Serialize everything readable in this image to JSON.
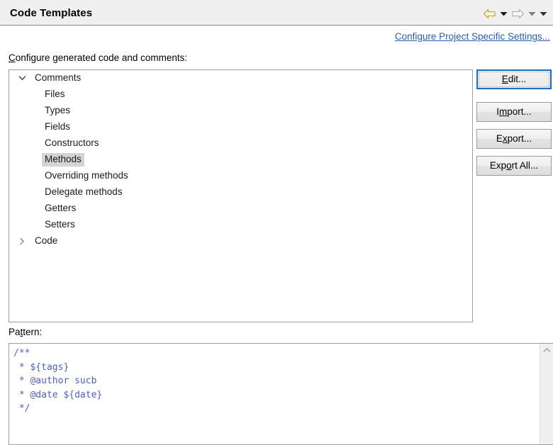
{
  "header": {
    "title": "Code Templates",
    "nav": [
      {
        "name": "back-arrow-icon",
        "glyph": "back",
        "color": "#d9b84c",
        "enabled": true
      },
      {
        "name": "back-dropdown-caret-icon",
        "glyph": "caret",
        "color": "#1a1a1a",
        "enabled": true
      },
      {
        "name": "forward-arrow-icon",
        "glyph": "forward",
        "color": "#b0b0b0",
        "enabled": false
      },
      {
        "name": "forward-dropdown-caret-icon",
        "glyph": "caret",
        "color": "#8a8a8a",
        "enabled": false
      },
      {
        "name": "menu-dropdown-caret-icon",
        "glyph": "caret",
        "color": "#2b2b5e",
        "enabled": true
      }
    ]
  },
  "links": {
    "project_specific_settings": "Configure Project Specific Settings..."
  },
  "section": {
    "label_mnemonic": "C",
    "label_rest": "onfigure generated code and comments:"
  },
  "tree": {
    "nodes": [
      {
        "label": "Comments",
        "level": 0,
        "twisty": "expanded",
        "selected": false
      },
      {
        "label": "Files",
        "level": 1,
        "twisty": "none",
        "selected": false
      },
      {
        "label": "Types",
        "level": 1,
        "twisty": "none",
        "selected": false
      },
      {
        "label": "Fields",
        "level": 1,
        "twisty": "none",
        "selected": false
      },
      {
        "label": "Constructors",
        "level": 1,
        "twisty": "none",
        "selected": false
      },
      {
        "label": "Methods",
        "level": 1,
        "twisty": "none",
        "selected": true
      },
      {
        "label": "Overriding methods",
        "level": 1,
        "twisty": "none",
        "selected": false
      },
      {
        "label": "Delegate methods",
        "level": 1,
        "twisty": "none",
        "selected": false
      },
      {
        "label": "Getters",
        "level": 1,
        "twisty": "none",
        "selected": false
      },
      {
        "label": "Setters",
        "level": 1,
        "twisty": "none",
        "selected": false
      },
      {
        "label": "Code",
        "level": 0,
        "twisty": "collapsed",
        "selected": false
      }
    ]
  },
  "buttons": [
    {
      "name": "edit-button",
      "pre": "E",
      "mnemonic": "",
      "post": "dit...",
      "full": "Edit...",
      "focused": true,
      "gap_after": true
    },
    {
      "name": "import-button",
      "pre": "I",
      "mnemonic": "m",
      "post": "port...",
      "full": "Import...",
      "focused": false,
      "gap_after": false
    },
    {
      "name": "export-button",
      "pre": "E",
      "mnemonic": "x",
      "post": "port...",
      "full": "Export...",
      "focused": false,
      "gap_after": false
    },
    {
      "name": "export-all-button",
      "pre": "Exp",
      "mnemonic": "o",
      "post": "rt All...",
      "full": "Export All...",
      "focused": false,
      "gap_after": false
    }
  ],
  "button_mnemonics": {
    "edit": {
      "before": "",
      "letter": "E",
      "after": "dit..."
    }
  },
  "pattern": {
    "label_pre": "Pa",
    "label_mnemonic": "t",
    "label_post": "tern:",
    "code": "/**\n * ${tags}\n * @author sucb\n * @date ${date}\n */",
    "text_color": "#4f5fbf",
    "scrollbar": {
      "up_arrow": "scroll-up-arrow-icon"
    }
  },
  "colors": {
    "header_bg": "#f0f0f0",
    "link": "#2a5db0",
    "selection": "#d4d4d4",
    "focus_border": "#1a6fc4",
    "javadoc": "#4f5fbf"
  }
}
